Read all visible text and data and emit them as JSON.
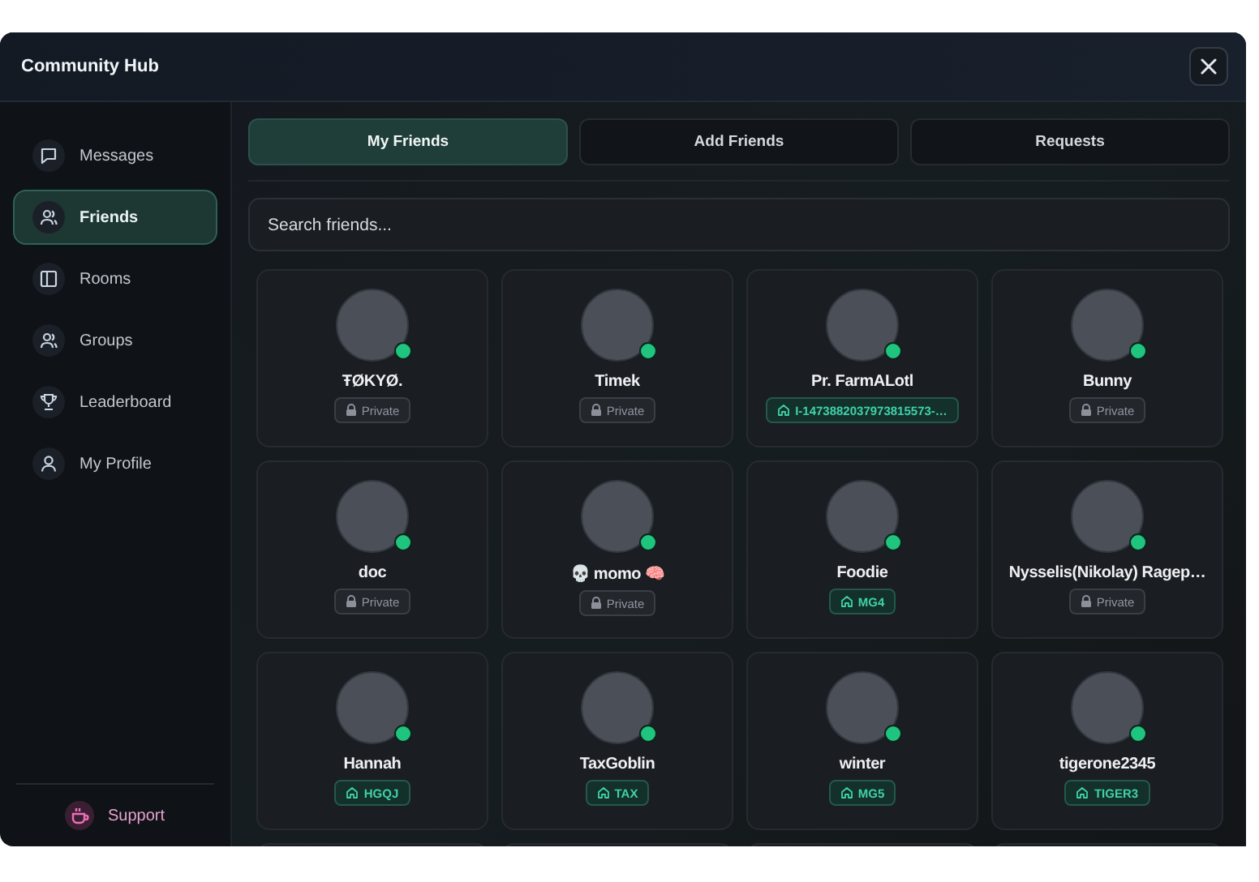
{
  "window": {
    "title": "Community Hub"
  },
  "sidebar": {
    "items": [
      {
        "label": "Messages",
        "kind": "message",
        "selected": false
      },
      {
        "label": "Friends",
        "kind": "friends",
        "selected": true
      },
      {
        "label": "Rooms",
        "kind": "rooms",
        "selected": false
      },
      {
        "label": "Groups",
        "kind": "friends",
        "selected": false
      },
      {
        "label": "Leaderboard",
        "kind": "trophy",
        "selected": false
      },
      {
        "label": "My Profile",
        "kind": "profile",
        "selected": false
      }
    ],
    "support": {
      "label": "Support"
    }
  },
  "tabs": [
    {
      "label": "My Friends",
      "selected": true
    },
    {
      "label": "Add Friends",
      "selected": false
    },
    {
      "label": "Requests",
      "selected": false
    }
  ],
  "search": {
    "placeholder": "Search friends..."
  },
  "friends": [
    {
      "name": "ŦØKYØ.",
      "online": true,
      "badge": {
        "kind": "private",
        "text": "Private"
      }
    },
    {
      "name": "Timek",
      "online": true,
      "badge": {
        "kind": "private",
        "text": "Private"
      }
    },
    {
      "name": "Pr. FarmALotl",
      "online": true,
      "badge": {
        "kind": "room",
        "text": "I-1473882037973815573-…"
      }
    },
    {
      "name": "Bunny",
      "online": true,
      "badge": {
        "kind": "private",
        "text": "Private"
      }
    },
    {
      "name": "doc",
      "online": true,
      "badge": {
        "kind": "private",
        "text": "Private"
      }
    },
    {
      "name": "💀 momo 🧠",
      "online": true,
      "badge": {
        "kind": "private",
        "text": "Private"
      }
    },
    {
      "name": "Foodie",
      "online": true,
      "badge": {
        "kind": "room",
        "text": "MG4"
      }
    },
    {
      "name": "Nysselis(Nikolay) Ragep…",
      "online": true,
      "badge": {
        "kind": "private",
        "text": "Private"
      }
    },
    {
      "name": "Hannah",
      "online": true,
      "badge": {
        "kind": "room",
        "text": "HGQJ"
      }
    },
    {
      "name": "TaxGoblin",
      "online": true,
      "badge": {
        "kind": "room",
        "text": "TAX"
      }
    },
    {
      "name": "winter",
      "online": true,
      "badge": {
        "kind": "room",
        "text": "MG5"
      }
    },
    {
      "name": "tigerone2345",
      "online": true,
      "badge": {
        "kind": "room",
        "text": "TIGER3"
      }
    }
  ]
}
